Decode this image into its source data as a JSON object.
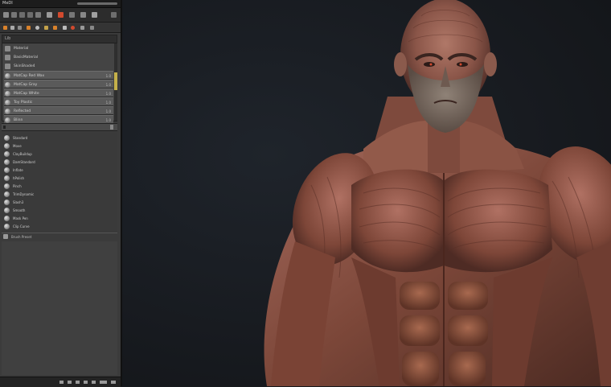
{
  "window": {
    "title": "MeDI"
  },
  "panel": {
    "section1_header": "Lib",
    "list_items": [
      {
        "label": "Material",
        "value": ""
      },
      {
        "label": "BasicMaterial",
        "value": ""
      },
      {
        "label": "SkinShade4",
        "value": ""
      },
      {
        "label": "MatCap Red Wax",
        "value": "1.0"
      },
      {
        "label": "MatCap Gray",
        "value": "1.0"
      },
      {
        "label": "MatCap White",
        "value": "1.0"
      },
      {
        "label": "Toy Plastic",
        "value": "1.0"
      },
      {
        "label": "Reflected",
        "value": "1.0"
      },
      {
        "label": "Blinn",
        "value": "1.0"
      }
    ],
    "subtools": [
      "Standard",
      "Move",
      "ClayBuildup",
      "DamStandard",
      "Inflate",
      "hPolish",
      "Pinch",
      "TrimDynamic",
      "Slash3",
      "Smooth",
      "Mask Pen",
      "Clip Curve"
    ],
    "footer_item": "Brush Preset"
  },
  "accent": {
    "scroll_thumb": "#c4b04a",
    "red_icon": "#d24a2e",
    "orange_icon": "#d9822b"
  },
  "viewport": {
    "subject": "muscle-anatomy-sculpt"
  }
}
